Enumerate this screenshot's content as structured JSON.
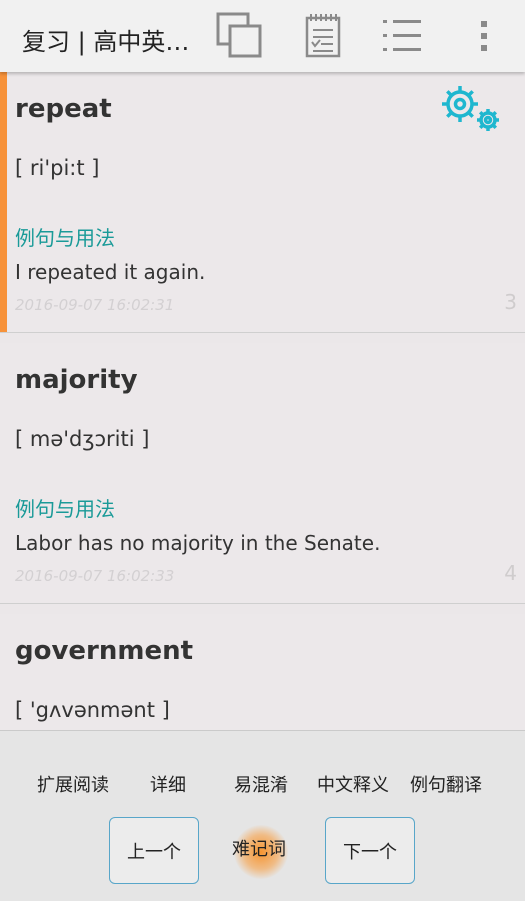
{
  "header": {
    "title": "复习 | 高中英…",
    "icons": [
      "copy-icon",
      "notepad-icon",
      "list-icon",
      "overflow-menu-icon"
    ]
  },
  "cards": [
    {
      "word": "repeat",
      "phonetic": "[ ri'pi:t ]",
      "section_label": "例句与用法",
      "example": "I repeated it again.",
      "timestamp": "2016-09-07 16:02:31",
      "index": "3",
      "active": true
    },
    {
      "word": "majority",
      "phonetic": "[ mə'dʒɔriti ]",
      "section_label": "例句与用法",
      "example": "Labor has no majority in the Senate.",
      "timestamp": "2016-09-07 16:02:33",
      "index": "4",
      "active": false
    },
    {
      "word": "government",
      "phonetic": "[ 'gʌvənmənt ]",
      "active": false
    }
  ],
  "bottom": {
    "tabs": [
      "扩展阅读",
      "详细",
      "易混淆",
      "中文释义",
      "例句翻译"
    ],
    "prev_label": "上一个",
    "hard_label": "难记词",
    "next_label": "下一个"
  },
  "colors": {
    "accent_orange": "#f7923a",
    "section_teal": "#1a9a98",
    "gear_cyan": "#1fb7cf",
    "button_border": "#58a6c9"
  }
}
